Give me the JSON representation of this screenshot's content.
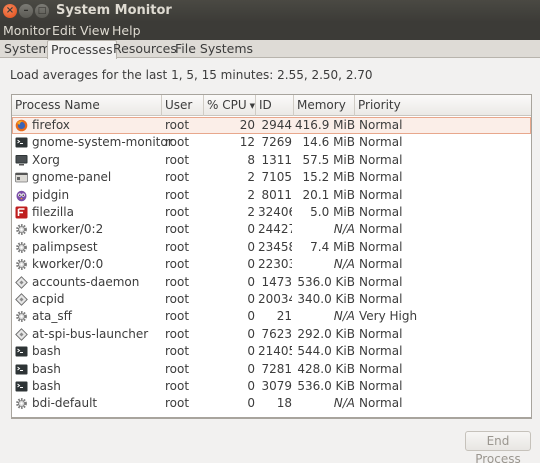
{
  "window": {
    "title": "System Monitor",
    "close_glyph": "×",
    "min_glyph": "–",
    "max_glyph": "□"
  },
  "menubar": {
    "items": [
      "Monitor",
      "Edit",
      "View",
      "Help"
    ]
  },
  "tabs": [
    {
      "label": "System",
      "active": false
    },
    {
      "label": "Processes",
      "active": true
    },
    {
      "label": "Resources",
      "active": false
    },
    {
      "label": "File Systems",
      "active": false
    }
  ],
  "load_averages": "Load averages for the last 1, 5, 15 minutes: 2.55, 2.50, 2.70",
  "columns": {
    "name": "Process Name",
    "user": "User",
    "cpu": "% CPU",
    "id": "ID",
    "memory": "Memory",
    "priority": "Priority",
    "sort_indicator": "▼"
  },
  "processes": [
    {
      "icon": "firefox-icon",
      "name": "firefox",
      "user": "root",
      "cpu": "20",
      "id": "2944",
      "memory": "416.9 MiB",
      "priority": "Normal",
      "selected": true
    },
    {
      "icon": "terminal-icon",
      "name": "gnome-system-monitor",
      "user": "root",
      "cpu": "12",
      "id": "7269",
      "memory": "14.6 MiB",
      "priority": "Normal"
    },
    {
      "icon": "monitor-icon",
      "name": "Xorg",
      "user": "root",
      "cpu": "8",
      "id": "1311",
      "memory": "57.5 MiB",
      "priority": "Normal"
    },
    {
      "icon": "panel-icon",
      "name": "gnome-panel",
      "user": "root",
      "cpu": "2",
      "id": "7105",
      "memory": "15.2 MiB",
      "priority": "Normal"
    },
    {
      "icon": "pidgin-icon",
      "name": "pidgin",
      "user": "root",
      "cpu": "2",
      "id": "8011",
      "memory": "20.1 MiB",
      "priority": "Normal"
    },
    {
      "icon": "filezilla-icon",
      "name": "filezilla",
      "user": "root",
      "cpu": "2",
      "id": "32406",
      "memory": "5.0 MiB",
      "priority": "Normal"
    },
    {
      "icon": "gear-icon",
      "name": "kworker/0:2",
      "user": "root",
      "cpu": "0",
      "id": "24427",
      "memory": "N/A",
      "priority": "Normal"
    },
    {
      "icon": "gear-icon",
      "name": "palimpsest",
      "user": "root",
      "cpu": "0",
      "id": "23458",
      "memory": "7.4 MiB",
      "priority": "Normal"
    },
    {
      "icon": "gear-icon",
      "name": "kworker/0:0",
      "user": "root",
      "cpu": "0",
      "id": "22303",
      "memory": "N/A",
      "priority": "Normal"
    },
    {
      "icon": "diamond-icon",
      "name": "accounts-daemon",
      "user": "root",
      "cpu": "0",
      "id": "1473",
      "memory": "536.0 KiB",
      "priority": "Normal"
    },
    {
      "icon": "diamond-icon",
      "name": "acpid",
      "user": "root",
      "cpu": "0",
      "id": "20034",
      "memory": "340.0 KiB",
      "priority": "Normal"
    },
    {
      "icon": "gear-icon",
      "name": "ata_sff",
      "user": "root",
      "cpu": "0",
      "id": "21",
      "memory": "N/A",
      "priority": "Very High"
    },
    {
      "icon": "diamond-icon",
      "name": "at-spi-bus-launcher",
      "user": "root",
      "cpu": "0",
      "id": "7623",
      "memory": "292.0 KiB",
      "priority": "Normal"
    },
    {
      "icon": "terminal-icon",
      "name": "bash",
      "user": "root",
      "cpu": "0",
      "id": "21405",
      "memory": "544.0 KiB",
      "priority": "Normal"
    },
    {
      "icon": "terminal-icon",
      "name": "bash",
      "user": "root",
      "cpu": "0",
      "id": "7281",
      "memory": "428.0 KiB",
      "priority": "Normal"
    },
    {
      "icon": "terminal-icon",
      "name": "bash",
      "user": "root",
      "cpu": "0",
      "id": "3079",
      "memory": "536.0 KiB",
      "priority": "Normal"
    },
    {
      "icon": "gear-icon",
      "name": "bdi-default",
      "user": "root",
      "cpu": "0",
      "id": "18",
      "memory": "N/A",
      "priority": "Normal"
    }
  ],
  "buttons": {
    "end_process": "End Process"
  },
  "colors": {
    "selection_fill": "#fbeee8",
    "selection_border": "#e8a78c",
    "close_button": "#df4a16",
    "titlebar": "#3c3b37"
  }
}
